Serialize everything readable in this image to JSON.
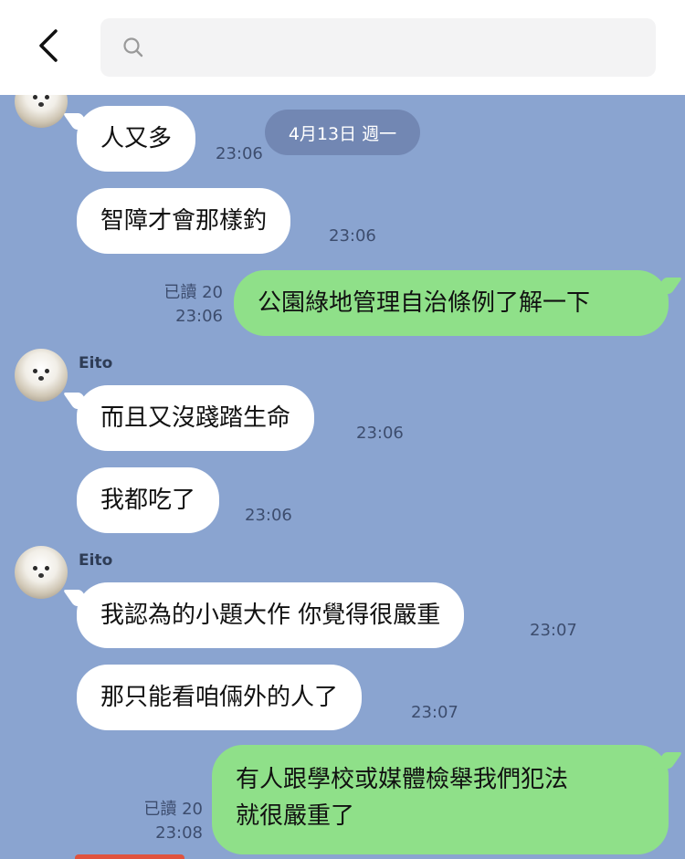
{
  "header": {
    "back_icon": "chevron-left-icon",
    "search_icon": "search-icon",
    "search_placeholder": ""
  },
  "date_divider": "4月13日 週一",
  "messages": [
    {
      "side": "in",
      "text": "人又多",
      "time": "23:06"
    },
    {
      "side": "in",
      "text": "智障才會那樣釣",
      "time": "23:06"
    },
    {
      "side": "out",
      "text": "公園綠地管理自治條例了解一下",
      "read": "已讀 20",
      "time": "23:06"
    },
    {
      "side": "in",
      "sender": "Eito",
      "text": "而且又沒踐踏生命",
      "time": "23:06"
    },
    {
      "side": "in",
      "text": "我都吃了",
      "time": "23:06"
    },
    {
      "side": "in",
      "sender": "Eito",
      "text": "我認為的小題大作 你覺得很嚴重",
      "time": "23:07"
    },
    {
      "side": "in",
      "text": "那只能看咱倆外的人了",
      "time": "23:07"
    },
    {
      "side": "out",
      "text_line1": "有人跟學校或媒體檢舉我們犯法",
      "text_line2": "就很嚴重了",
      "read": "已讀 20",
      "time": "23:08"
    }
  ],
  "colors": {
    "chat_background": "#8aa4d0",
    "incoming_bubble": "#ffffff",
    "outgoing_bubble": "#8fe089",
    "date_pill": "#7287b3"
  }
}
